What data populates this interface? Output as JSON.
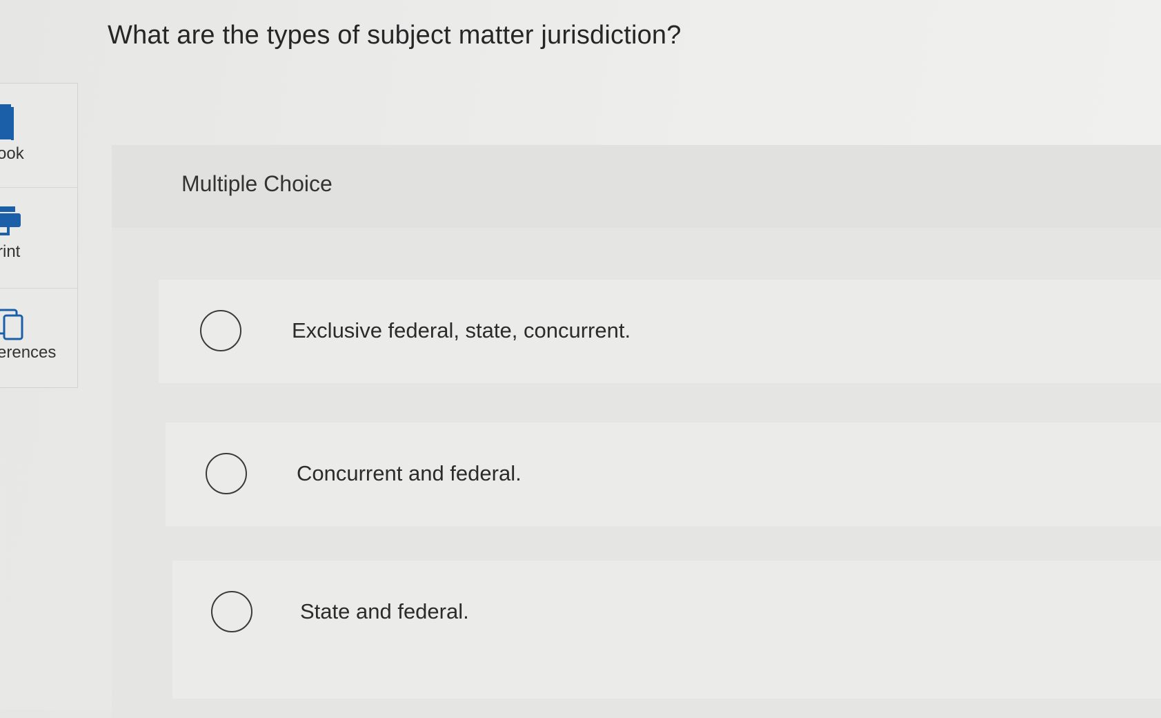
{
  "question": {
    "title": "What are the types of subject matter jurisdiction?",
    "type_label": "Multiple Choice",
    "options": [
      {
        "label": "Exclusive federal, state, concurrent."
      },
      {
        "label": "Concurrent and federal."
      },
      {
        "label": "State and federal."
      }
    ]
  },
  "toolbar": {
    "items": [
      {
        "label": "ook",
        "icon": "book-icon"
      },
      {
        "label": "rint",
        "icon": "print-icon"
      },
      {
        "label": "erences",
        "icon": "references-icon"
      }
    ]
  },
  "colors": {
    "icon_blue": "#1a5fa8",
    "text": "#2a2a2a",
    "radio_border": "#3a3a3a"
  }
}
